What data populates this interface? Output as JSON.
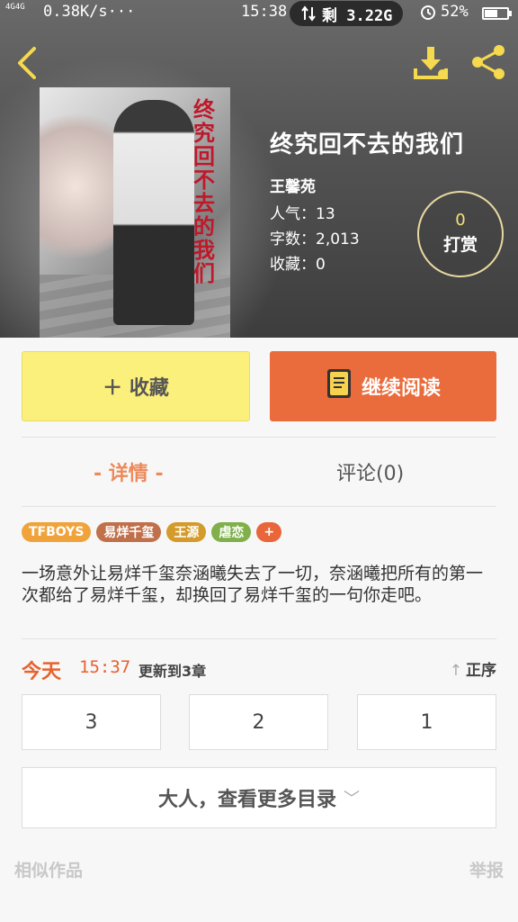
{
  "status_bar": {
    "network": "4G4G",
    "speed": "0.38K/s···",
    "time": "15:38",
    "data_remaining": "剩 3.22G",
    "alarm_icon": "alarm-icon",
    "battery": "52%"
  },
  "header": {
    "back_icon": "chevron-left-icon",
    "download_icon": "download-icon",
    "share_icon": "share-icon",
    "accent_color": "#f5d94e"
  },
  "book": {
    "cover_title": "终究回不去的我们",
    "title": "终究回不去的我们",
    "author": "王馨苑",
    "popularity": "人气：13",
    "word_count": "字数：2,013",
    "favorites": "收藏：0"
  },
  "tip": {
    "count": "0",
    "label": "打赏"
  },
  "actions": {
    "favorite_label": "＋ 收藏",
    "read_label": "继续阅读",
    "favorite_color": "#fbf07c",
    "read_color": "#ea6b3b"
  },
  "tabs": [
    {
      "label": "- 详情 -",
      "active": true
    },
    {
      "label": "评论(0)",
      "active": false
    }
  ],
  "tags": [
    {
      "label": "TFBOYS",
      "color": "#f0a33a"
    },
    {
      "label": "易烊千玺",
      "color": "#c0704a"
    },
    {
      "label": "王源",
      "color": "#d49a2a"
    },
    {
      "label": "虐恋",
      "color": "#7fb04a"
    },
    {
      "label": "+",
      "color": "#e8663a"
    }
  ],
  "intro": "一场意外让易烊千玺奈涵曦失去了一切，奈涵曦把所有的第一次都给了易烊千玺，却换回了易烊千玺的一句你走吧。",
  "update": {
    "day": "今天",
    "time": "15:37",
    "text": "更新到3章",
    "order": "正序"
  },
  "chapters": [
    "3",
    "2",
    "1"
  ],
  "more_catalog": "大人，查看更多目录",
  "footer": {
    "similar": "相似作品",
    "report": "举报"
  }
}
